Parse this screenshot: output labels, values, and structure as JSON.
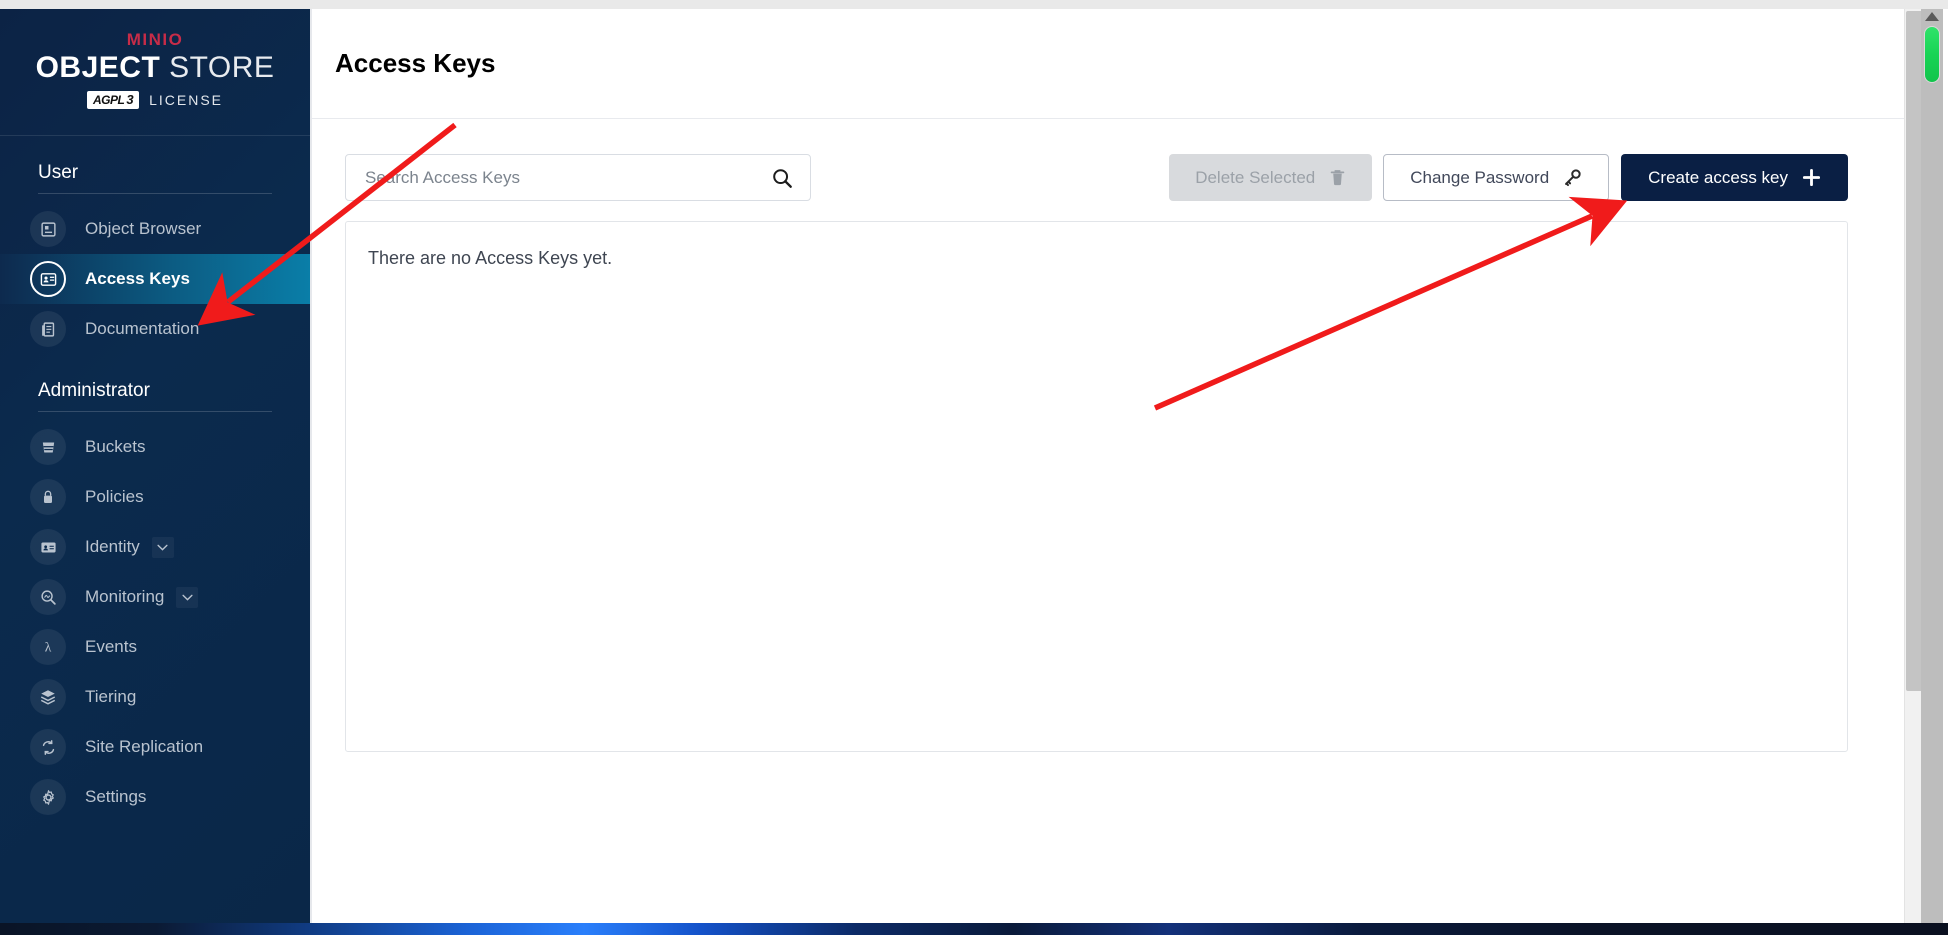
{
  "brand": {
    "minio": "MINIO",
    "object": "OBJECT",
    "store": "STORE",
    "agpl": "AGPL",
    "agpl_version": "3",
    "license": "LICENSE"
  },
  "sidebar": {
    "sections": [
      {
        "title": "User",
        "items": [
          {
            "label": "Object Browser",
            "icon": "object-browser-icon",
            "active": false,
            "expandable": false
          },
          {
            "label": "Access Keys",
            "icon": "access-keys-icon",
            "active": true,
            "expandable": false
          },
          {
            "label": "Documentation",
            "icon": "documentation-icon",
            "active": false,
            "expandable": false
          }
        ]
      },
      {
        "title": "Administrator",
        "items": [
          {
            "label": "Buckets",
            "icon": "bucket-icon",
            "active": false,
            "expandable": false
          },
          {
            "label": "Policies",
            "icon": "lock-icon",
            "active": false,
            "expandable": false
          },
          {
            "label": "Identity",
            "icon": "identity-card-icon",
            "active": false,
            "expandable": true
          },
          {
            "label": "Monitoring",
            "icon": "monitoring-icon",
            "active": false,
            "expandable": true
          },
          {
            "label": "Events",
            "icon": "lambda-icon",
            "active": false,
            "expandable": false
          },
          {
            "label": "Tiering",
            "icon": "layers-icon",
            "active": false,
            "expandable": false
          },
          {
            "label": "Site Replication",
            "icon": "replication-icon",
            "active": false,
            "expandable": false
          },
          {
            "label": "Settings",
            "icon": "gear-icon",
            "active": false,
            "expandable": false
          }
        ]
      }
    ]
  },
  "page": {
    "title": "Access Keys"
  },
  "search": {
    "placeholder": "Search Access Keys",
    "value": "",
    "icon": "search-icon"
  },
  "toolbar": {
    "delete_selected_label": "Delete Selected",
    "delete_selected_icon": "trash-icon",
    "delete_selected_disabled": true,
    "change_password_label": "Change Password",
    "change_password_icon": "key-icon",
    "create_access_key_label": "Create access key",
    "create_access_key_icon": "plus-icon"
  },
  "content": {
    "empty_message": "There are no Access Keys yet."
  },
  "colors": {
    "sidebar_bg": "#0b2a4d",
    "accent_active": "#0a7ea8",
    "primary_button": "#0a1f44",
    "brand_red": "#c72c48",
    "scroll_thumb_green": "#18d455",
    "annotation_red": "#f01b1b"
  },
  "annotations": {
    "arrow_to_access_keys": "arrow pointing to Access Keys sidebar item",
    "arrow_to_create_key": "arrow pointing to Create access key button"
  }
}
